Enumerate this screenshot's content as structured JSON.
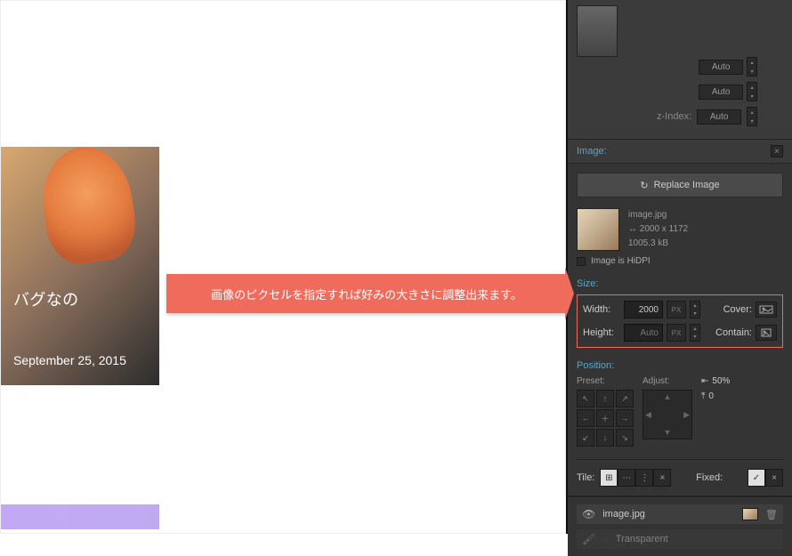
{
  "card": {
    "title": "バグなの",
    "date": "September 25, 2015"
  },
  "callout": "画像のピクセルを指定すれば好みの大きさに調整出来ます。",
  "topControls": {
    "auto": "Auto",
    "zindexLabel": "z-Index:",
    "zindexValue": "Auto"
  },
  "panel": {
    "title": "Image:",
    "replaceButton": "Replace Image",
    "file": {
      "name": "image.jpg",
      "dimensions": "2000 x 1172",
      "filesize": "1005.3 kB",
      "hidpi": "Image is HiDPI"
    },
    "size": {
      "label": "Size:",
      "widthLabel": "Width:",
      "widthValue": "2000",
      "widthUnit": "PX",
      "heightLabel": "Height:",
      "heightValue": "Auto",
      "heightUnit": "PX",
      "coverLabel": "Cover:",
      "containLabel": "Contain:"
    },
    "position": {
      "label": "Position:",
      "presetLabel": "Preset:",
      "adjustLabel": "Adjust:",
      "hOffset": "50%",
      "vOffset": "0"
    },
    "tile": {
      "label": "Tile:",
      "fixedLabel": "Fixed:"
    }
  },
  "layers": {
    "item1": "image.jpg",
    "item2": "Transparent"
  },
  "icons": {
    "replace": "↻",
    "check": "✓",
    "cross": "×",
    "dims": "↔"
  }
}
